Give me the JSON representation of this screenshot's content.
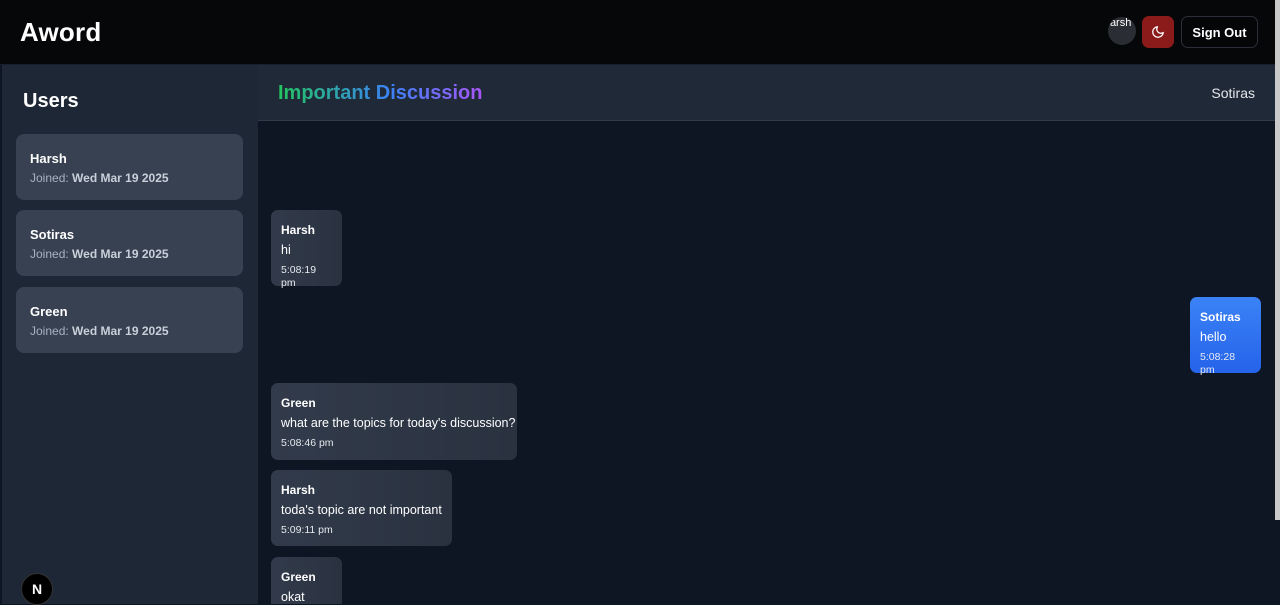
{
  "header": {
    "brand": "Aword",
    "avatar_text": "Harsh Chat",
    "sign_out_label": "Sign Out"
  },
  "sidebar": {
    "title": "Users",
    "joined_prefix": "Joined:",
    "users": [
      {
        "name": "Harsh",
        "joined": "Wed Mar 19 2025"
      },
      {
        "name": "Sotiras",
        "joined": "Wed Mar 19 2025"
      },
      {
        "name": "Green",
        "joined": "Wed Mar 19 2025"
      }
    ],
    "framework_badge": "N"
  },
  "chat": {
    "title": "Important Discussion",
    "current_user": "Sotiras",
    "messages": [
      {
        "sender": "Harsh",
        "text": "hi",
        "time": "5:08:19 pm",
        "mine": false
      },
      {
        "sender": "Sotiras",
        "text": "hello",
        "time": "5:08:28 pm",
        "mine": true
      },
      {
        "sender": "Green",
        "text": "what are the topics for today's discussion?",
        "time": "5:08:46 pm",
        "mine": false
      },
      {
        "sender": "Harsh",
        "text": "toda's topic are not important",
        "time": "5:09:11 pm",
        "mine": false
      },
      {
        "sender": "Green",
        "text": "okat",
        "time": "",
        "mine": false
      }
    ]
  },
  "colors": {
    "accent_blue": "#3b82f6",
    "theme_toggle": "#8b1a1a",
    "title_gradient": [
      "#22c55e",
      "#3b82f6",
      "#a855f7"
    ]
  },
  "icons": {
    "theme_toggle": "moon-icon"
  }
}
